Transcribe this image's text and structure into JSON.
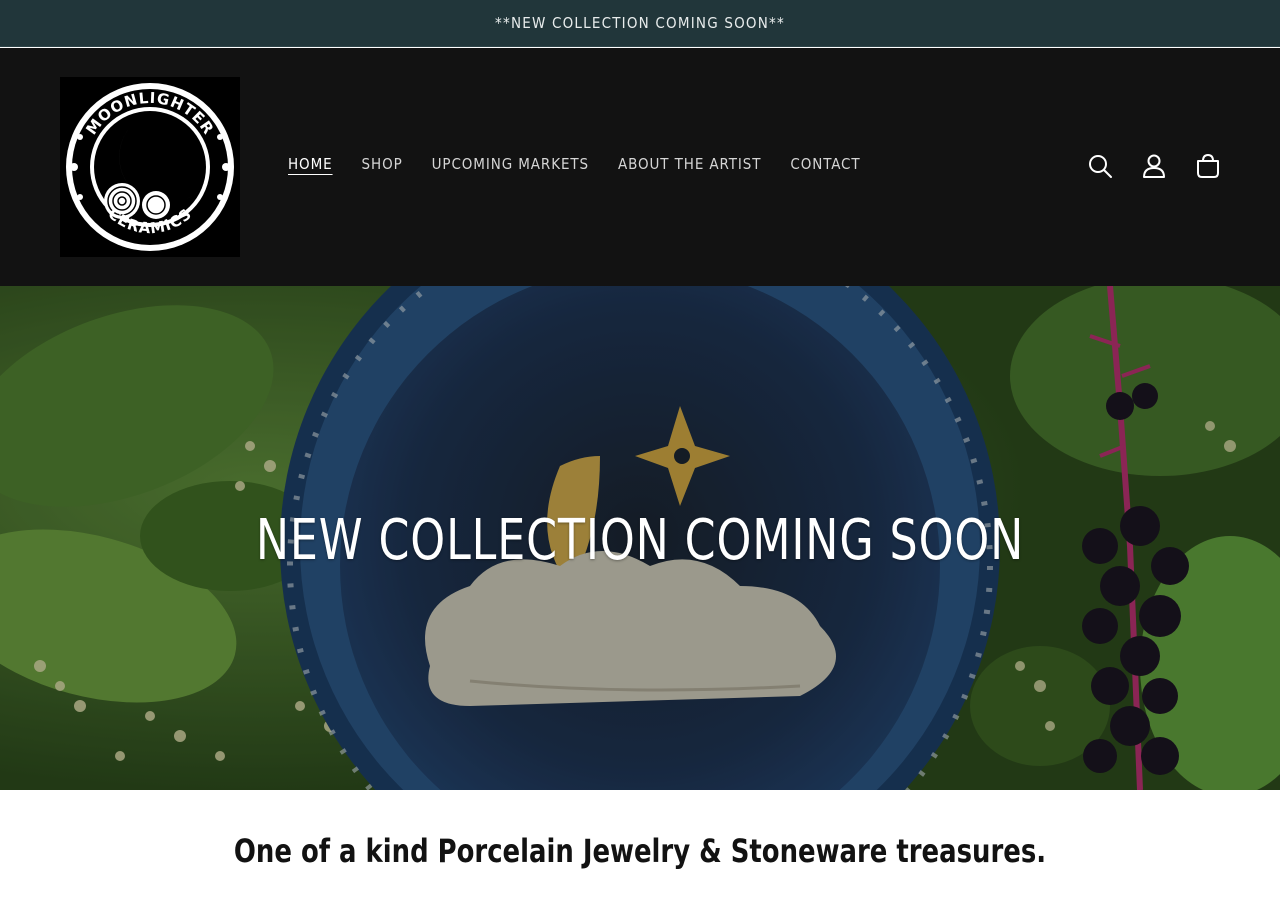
{
  "announcement": {
    "text": "**NEW COLLECTION COMING SOON**"
  },
  "brand": {
    "logo_top_text": "MOONLIGHTER",
    "logo_bottom_text": "CERAMICS"
  },
  "nav": {
    "items": [
      {
        "label": "HOME",
        "active": true
      },
      {
        "label": "SHOP",
        "active": false
      },
      {
        "label": "UPCOMING MARKETS",
        "active": false
      },
      {
        "label": "ABOUT THE ARTIST",
        "active": false
      },
      {
        "label": "CONTACT",
        "active": false
      }
    ]
  },
  "header_icons": [
    "search-icon",
    "account-icon",
    "cart-icon"
  ],
  "hero": {
    "title": "NEW COLLECTION COMING SOON"
  },
  "tagline": {
    "text": "One of a kind Porcelain Jewelry & Stoneware treasures."
  },
  "colors": {
    "announcement_bg": "#21363a",
    "header_bg": "#121212",
    "text_light": "#ffffff",
    "text_dark": "#121212"
  }
}
